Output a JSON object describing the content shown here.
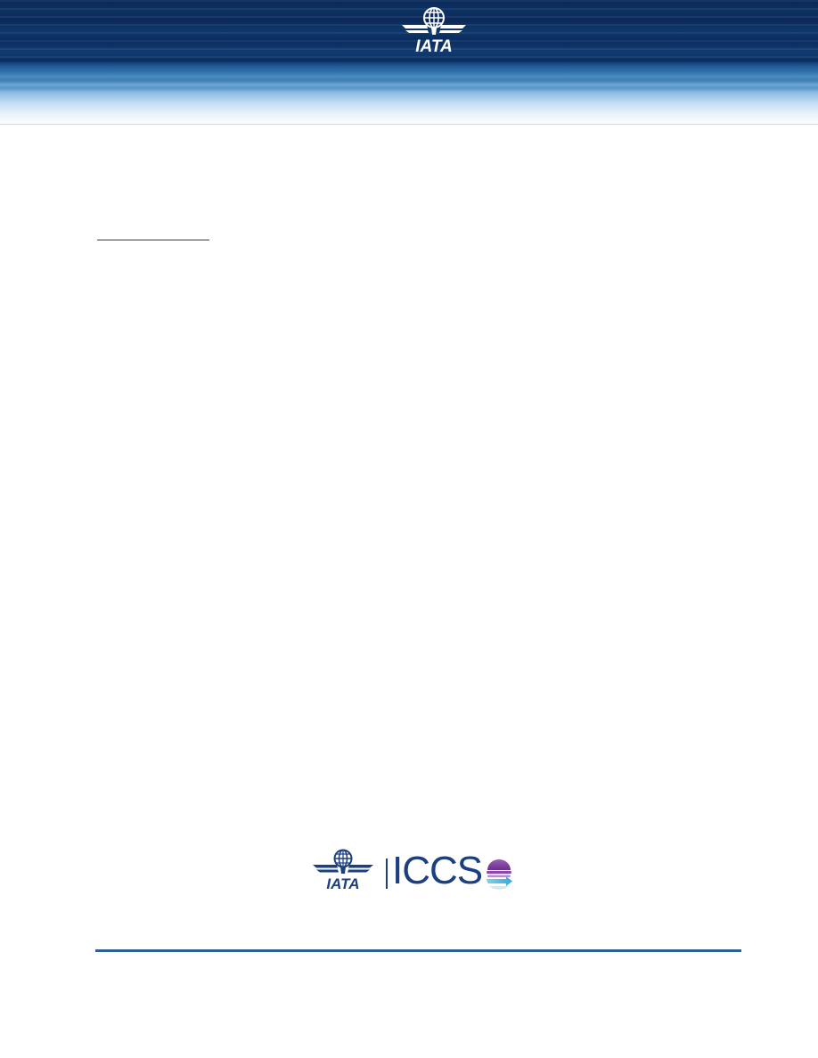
{
  "header": {
    "logo_icon": "iata-logo-icon",
    "logo_text": "IATA",
    "colors": {
      "navy": "#0a2a5c",
      "light_blue": "#a6cdea"
    }
  },
  "footer": {
    "iata_text": "IATA",
    "product_name": "ICCS",
    "globe_icon": "iccs-globe-icon",
    "colors": {
      "brand_blue": "#1b3f7f",
      "purple": "#7b3f98",
      "cyan": "#5bc0eb"
    }
  }
}
